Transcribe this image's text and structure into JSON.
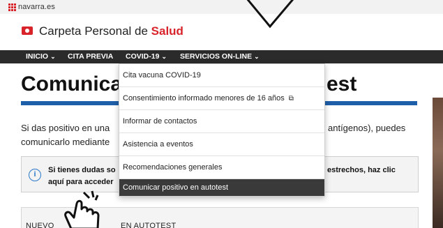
{
  "site": {
    "name": "navarra.es"
  },
  "brand": {
    "prefix": "Carpeta Personal de ",
    "highlight": "Salud"
  },
  "menu": {
    "items": [
      {
        "label": "INICIO",
        "has_dropdown": true
      },
      {
        "label": "CITA PREVIA",
        "has_dropdown": false
      },
      {
        "label": "COVID-19",
        "has_dropdown": true
      },
      {
        "label": "SERVICIOS ON-LINE",
        "has_dropdown": true
      }
    ]
  },
  "dropdown": {
    "items": [
      {
        "label": "Cita vacuna COVID-19"
      },
      {
        "label": "Consentimiento informado menores de 16 años",
        "external": true
      },
      {
        "label": "Informar de contactos"
      },
      {
        "label": "Asistencia a eventos"
      },
      {
        "label": "Recomendaciones generales"
      },
      {
        "label": "Comunicar positivo en autotest",
        "active": true
      }
    ]
  },
  "page": {
    "title_left": "Comunica",
    "title_right": "est",
    "paragraph": {
      "line1_left": "Si das positivo en una",
      "line1_right": "antígenos), puedes",
      "line2_left": "comunicarlo mediante"
    },
    "info": {
      "icon": "i",
      "line1_left": "Si tienes dudas so",
      "line1_right": "estrechos, haz clic",
      "line2_left": "aquí para acceder"
    },
    "card": {
      "heading_left": "NUEVO",
      "heading_right": "EN AUTOTEST"
    }
  },
  "colors": {
    "accent_red": "#d8232a",
    "nav_dark": "#2b2b2b",
    "title_underline": "#1f5ea8",
    "info_blue": "#2a77c9"
  },
  "icons": [
    "navarra-logo-icon",
    "carpeta-salud-icon",
    "chevron-down-icon",
    "external-link-icon",
    "info-icon",
    "hand-pointer-icon",
    "chevron-overlay-icon"
  ]
}
